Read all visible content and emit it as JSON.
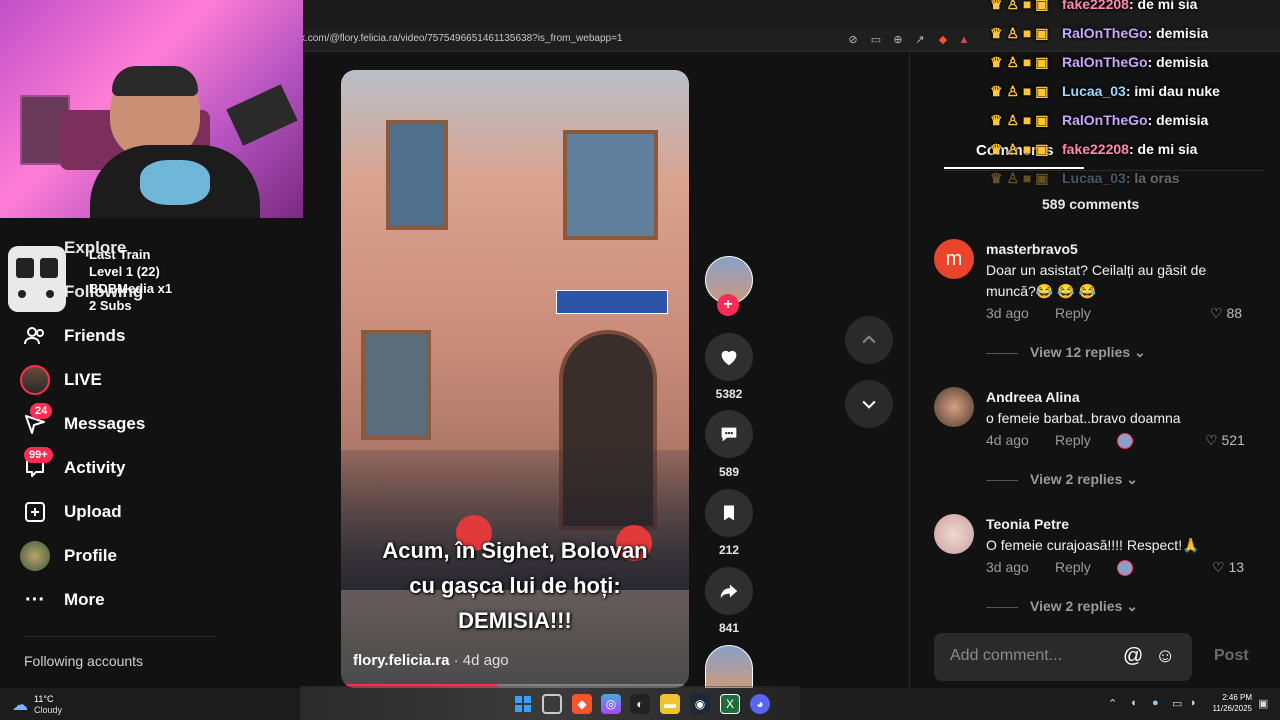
{
  "browser": {
    "url": "k.com/@flory.felicia.ra/video/7575496651461135638?is_from_webapp=1"
  },
  "webcam_overlay": {
    "stream_label_1": "Last Train",
    "stream_label_2": "Level 1  (22)",
    "stream_label_3": "BDBMedia x1",
    "stream_label_4": "2 Subs"
  },
  "sidebar": {
    "items": [
      {
        "label": "Explore",
        "icon": "compass-icon"
      },
      {
        "label": "Following",
        "icon": "following-icon"
      },
      {
        "label": "Friends",
        "icon": "friends-icon"
      },
      {
        "label": "LIVE",
        "icon": "live-icon"
      },
      {
        "label": "Messages",
        "icon": "messages-icon",
        "badge": "24"
      },
      {
        "label": "Activity",
        "icon": "activity-icon",
        "badge": "99+"
      },
      {
        "label": "Upload",
        "icon": "upload-icon"
      },
      {
        "label": "Profile",
        "icon": "profile-icon"
      },
      {
        "label": "More",
        "icon": "more-icon"
      }
    ],
    "following_accounts": "Following accounts"
  },
  "video": {
    "caption_line1": "Acum, în Sighet, Bolovan",
    "caption_line2": "cu gașca lui de hoți:",
    "caption_line3": "DEMISIA!!!",
    "author": "flory.felicia.ra",
    "age": " · 4d ago",
    "progress_fraction": 0.45
  },
  "actions": {
    "likes": "5382",
    "comments": "589",
    "saves": "212",
    "shares": "841"
  },
  "comments_panel": {
    "tab_label": "Comments",
    "count_label": "589 comments",
    "comments": [
      {
        "user": "masterbravo5",
        "avatar_letter": "m",
        "text": "Doar un asistat? Ceilalți au găsit de muncă?😂 😂 😂",
        "age": "3d ago",
        "reply": "Reply",
        "likes": "88",
        "view_replies": "View 12 replies"
      },
      {
        "user": "Andreea Alina",
        "text": "o femeie barbat..bravo doamna",
        "age": "4d ago",
        "reply": "Reply",
        "likes": "521",
        "view_replies": "View 2 replies"
      },
      {
        "user": "Teonia Petre",
        "text": "O femeie curajoasă!!!! Respect!🙏",
        "age": "3d ago",
        "reply": "Reply",
        "likes": "13",
        "view_replies": "View 2 replies"
      }
    ],
    "add_comment_placeholder": "Add comment...",
    "post_label": "Post"
  },
  "chat": [
    {
      "user": "fake22208",
      "message": "de mi sia",
      "color": "#ff8ab0"
    },
    {
      "user": "RalOnTheGo",
      "message": "demisia",
      "color": "#c9a8ff"
    },
    {
      "user": "RalOnTheGo",
      "message": "demisia",
      "color": "#c9a8ff"
    },
    {
      "user": "Lucaa_03",
      "message": "imi dau nuke",
      "color": "#9fd8ff"
    },
    {
      "user": "RalOnTheGo",
      "message": "demisia",
      "color": "#c9a8ff"
    },
    {
      "user": "fake22208",
      "message": "de mi sia",
      "color": "#ff8ab0"
    },
    {
      "user": "Lucaa_03",
      "message": "la oras",
      "color": "#9fd8ff"
    }
  ],
  "taskbar": {
    "weather_temp": "11°C",
    "weather_desc": "Cloudy",
    "time": "2:46 PM",
    "date": "11/26/2025"
  },
  "colors": {
    "accent": "#fe2c55",
    "background": "#121212"
  }
}
